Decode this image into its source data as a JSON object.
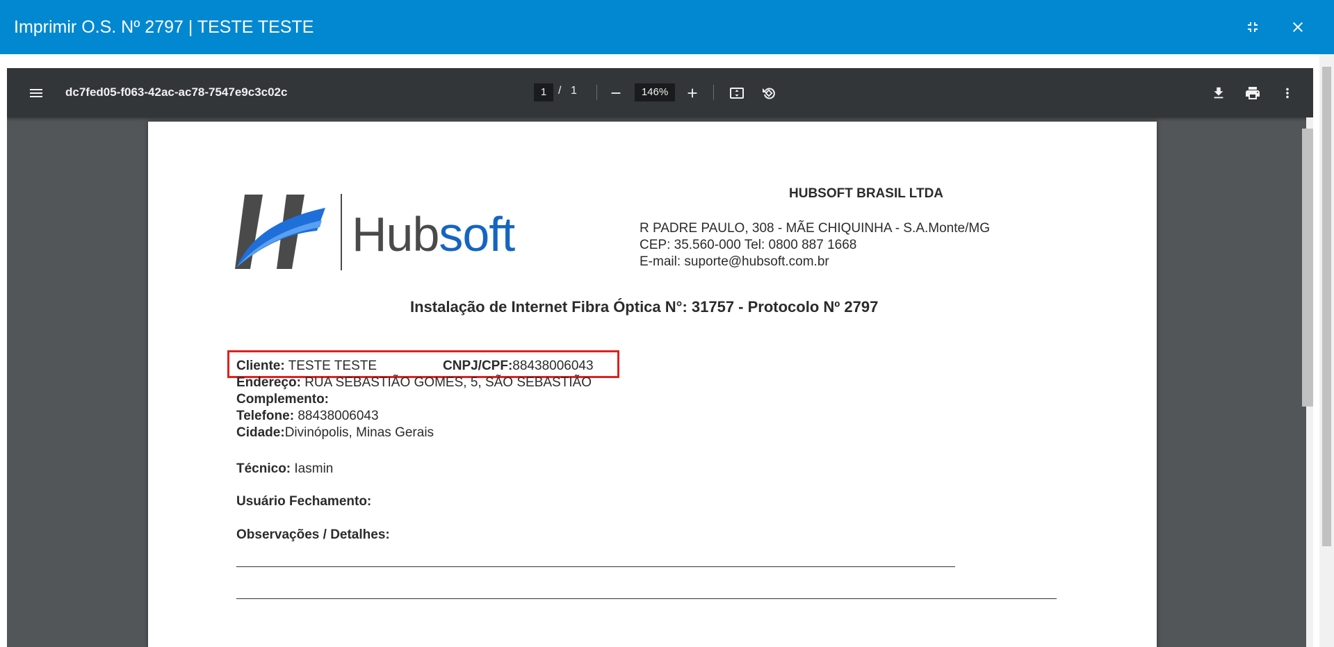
{
  "modal": {
    "title": "Imprimir O.S. Nº 2797 | TESTE TESTE"
  },
  "viewer": {
    "document_name": "dc7fed05-f063-42ac-ac78-7547e9c3c02c",
    "current_page": "1",
    "page_separator": "/",
    "total_pages": "1",
    "zoom": "146%"
  },
  "document": {
    "logo_text_dark": "Hub",
    "logo_text_blue": "soft",
    "company": {
      "name": "HUBSOFT BRASIL LTDA",
      "address": "R PADRE PAULO, 308 - MÃE CHIQUINHA - S.A.Monte/MG",
      "cep_tel": "CEP: 35.560-000 Tel: 0800 887 1668",
      "email": "E-mail: suporte@hubsoft.com.br"
    },
    "heading": "Instalação de Internet Fibra Óptica N°: 31757 - Protocolo Nº 2797",
    "fields": {
      "cliente_label": "Cliente:",
      "cliente_value": "TESTE TESTE",
      "cnpj_label": "CNPJ/CPF:",
      "cnpj_value": "88438006043",
      "endereco_label": "Endereço:",
      "endereco_value": "RUA SEBASTIÃO GOMES, 5, SÃO SEBASTIÃO",
      "complemento_label": "Complemento:",
      "telefone_label": "Telefone:",
      "telefone_value": "88438006043",
      "cidade_label": "Cidade:",
      "cidade_value": "Divinópolis, Minas Gerais",
      "tecnico_label": "Técnico:",
      "tecnico_value": "Iasmin",
      "usuario_label": "Usuário Fechamento:",
      "observacoes_label": "Observações / Detalhes:"
    }
  },
  "colors": {
    "header_blue": "#0288d1",
    "viewer_bg": "#525659",
    "toolbar_bg": "#323639",
    "highlight_red": "#e02020",
    "logo_blue": "#1565c0",
    "logo_gray": "#4a4a4a"
  },
  "icons": {
    "minimize": "compress-icon",
    "close": "close-icon",
    "menu": "menu-icon",
    "zoom_out": "minus-icon",
    "zoom_in": "plus-icon",
    "fit": "fit-page-icon",
    "rotate": "rotate-icon",
    "download": "download-icon",
    "print": "print-icon",
    "more": "more-vert-icon"
  }
}
